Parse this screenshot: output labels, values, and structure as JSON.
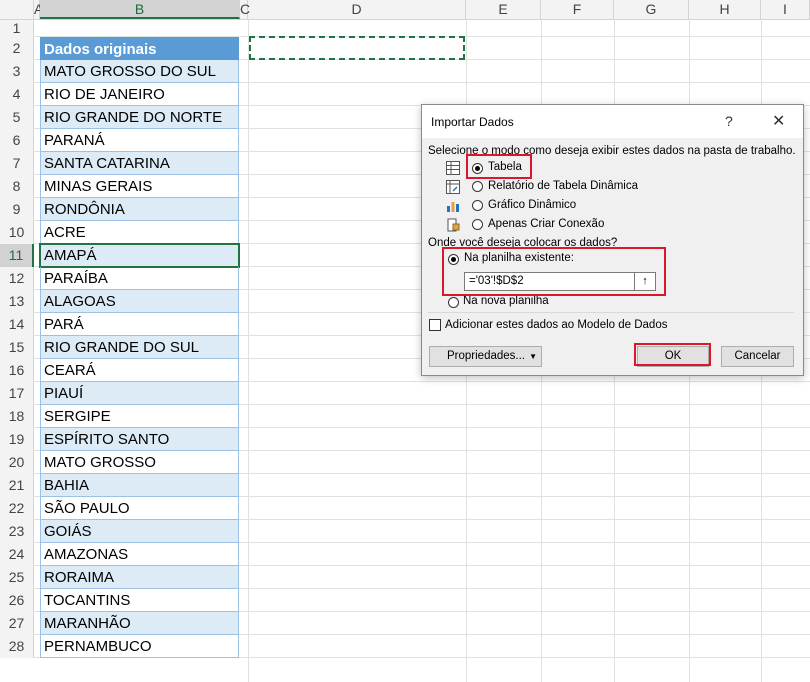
{
  "columns": [
    "A",
    "B",
    "C",
    "D",
    "E",
    "F",
    "G",
    "H",
    "I"
  ],
  "rows": [
    "1",
    "2",
    "3",
    "4",
    "5",
    "6",
    "7",
    "8",
    "9",
    "10",
    "11",
    "12",
    "13",
    "14",
    "15",
    "16",
    "17",
    "18",
    "19",
    "20",
    "21",
    "22",
    "23",
    "24",
    "25",
    "26",
    "27",
    "28"
  ],
  "table": {
    "header": "Dados originais",
    "items": [
      "MATO GROSSO DO SUL",
      "RIO DE JANEIRO",
      "RIO GRANDE DO NORTE",
      "PARANÁ",
      "SANTA CATARINA",
      "MINAS GERAIS",
      "RONDÔNIA",
      "ACRE",
      "AMAPÁ",
      "PARAÍBA",
      "ALAGOAS",
      "PARÁ",
      "RIO GRANDE DO SUL",
      "CEARÁ",
      "PIAUÍ",
      "SERGIPE",
      "ESPÍRITO SANTO",
      "MATO GROSSO",
      "BAHIA",
      "SÃO PAULO",
      "GOIÁS",
      "AMAZONAS",
      "RORAIMA",
      "TOCANTINS",
      "MARANHÃO",
      "PERNAMBUCO"
    ]
  },
  "dialog": {
    "title": "Importar Dados",
    "help": "?",
    "close": "✕",
    "prompt_view": "Selecione o modo como deseja exibir estes dados na pasta de trabalho.",
    "options_view": [
      "Tabela",
      "Relatório de Tabela Dinâmica",
      "Gráfico Dinâmico",
      "Apenas Criar Conexão"
    ],
    "prompt_place": "Onde você deseja colocar os dados?",
    "place_existing": "Na planilha existente:",
    "place_ref": "='03'!$D$2",
    "place_new": "Na nova planilha",
    "model_checkbox": "Adicionar estes dados ao Modelo de Dados",
    "btn_properties": "Propriedades...",
    "btn_ok": "OK",
    "btn_cancel": "Cancelar"
  },
  "colors": {
    "accent": "#217346",
    "table_header": "#5b9bd5",
    "band": "#ddebf7",
    "highlight": "#d9182b"
  }
}
